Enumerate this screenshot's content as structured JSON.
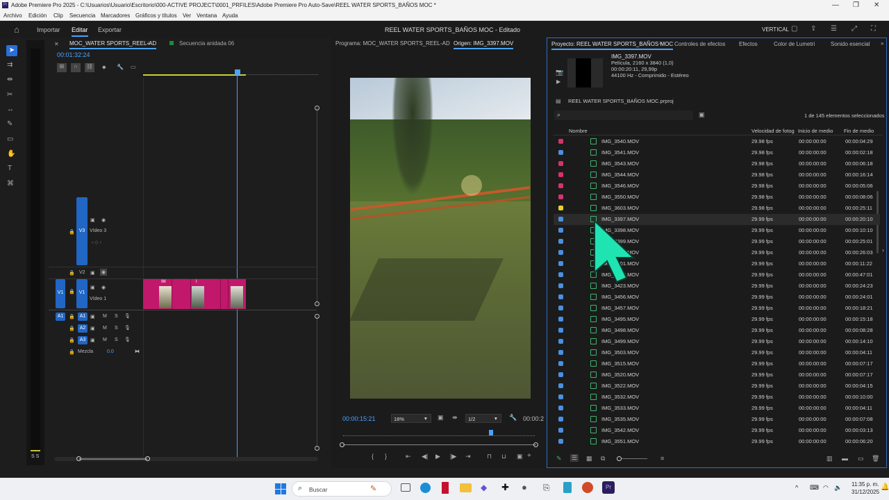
{
  "window": {
    "title": "Adobe Premiere Pro 2025 - C:\\Usuarios\\Usuario\\Escritorio\\000-ACTIVE PROJECT\\0001_PRFILES\\Adobe Premiere Pro Auto-Save\\REEL WATER SPORTS_BAÑOS MOC *",
    "minimize": "—",
    "maximize": "❐",
    "close": "✕"
  },
  "menu": [
    "Archivo",
    "Edición",
    "Clip",
    "Secuencia",
    "Marcadores",
    "Gráficos y títulos",
    "Ver",
    "Ventana",
    "Ayuda"
  ],
  "header": {
    "import": "Importar",
    "edit": "Editar",
    "export": "Exportar",
    "doc_title": "REEL WATER SPORTS_BAÑOS MOC - Editado",
    "vertical": "VERTICAL"
  },
  "timeline": {
    "tab_active": "MOC_WATER SPORTS_REEL-AD",
    "tab_other": "Secuencia anidada 06",
    "timecode": "00:01:32:24",
    "tracks": {
      "v3": "V3",
      "video3": "Vídeo 3",
      "v2": "V2",
      "v1_src": "V1",
      "v1": "V1",
      "video1": "Vídeo 1",
      "a1_src": "A1",
      "a1": "A1",
      "a2": "A2",
      "a3": "A3",
      "m": "M",
      "s": "S",
      "mix": "Mezcla",
      "mix_val": "0.0"
    },
    "clip_labels": [
      "IM",
      "I"
    ]
  },
  "program": {
    "title": "Programa: MOC_WATER SPORTS_REEL-AD",
    "source": "Origen: IMG_3397.MOV",
    "timecode": "00:00:15:21",
    "zoom": "18%",
    "quality": "1/2",
    "end_tc": "00:00:2"
  },
  "project": {
    "tab_active": "Proyecto: REEL WATER SPORTS_BAÑOS MOC",
    "tabs": [
      "Controles de efectos",
      "Efectos",
      "Color de Lumetri",
      "Sonido esencial"
    ],
    "preview": {
      "name": "IMG_3397.MOV",
      "line1": "Película, 2160 x 3840 (1,0)",
      "line2": "00:00:20:11, 29,99p",
      "line3": "44100 Hz - Comprimido - Estéreo"
    },
    "file": "REEL WATER SPORTS_BAÑOS MOC.prproj",
    "selection": "1 de 145 elementos seleccionados",
    "columns": {
      "name": "Nombre",
      "fps": "Velocidad de fotogr",
      "start": "Inicio de medio",
      "end": "Fin de medio"
    },
    "rows": [
      {
        "name": "IMG_3540.MOV",
        "fps": "29.98 fps",
        "start": "00:00:00:00",
        "end": "00:00:04:29",
        "color": "#d6336c"
      },
      {
        "name": "IMG_3541.MOV",
        "fps": "29.98 fps",
        "start": "00:00:00:00",
        "end": "00:00:02:18",
        "color": "#4a90e2"
      },
      {
        "name": "IMG_3543.MOV",
        "fps": "29.98 fps",
        "start": "00:00:00:00",
        "end": "00:00:06:18",
        "color": "#d6336c"
      },
      {
        "name": "IMG_3544.MOV",
        "fps": "29.98 fps",
        "start": "00:00:00:00",
        "end": "00:00:16:14",
        "color": "#d6336c"
      },
      {
        "name": "IMG_3546.MOV",
        "fps": "29.98 fps",
        "start": "00:00:00:00",
        "end": "00:00:05:06",
        "color": "#d6336c"
      },
      {
        "name": "IMG_3550.MOV",
        "fps": "29.98 fps",
        "start": "00:00:00:00",
        "end": "00:00:08:06",
        "color": "#d6336c"
      },
      {
        "name": "IMG_3603.MOV",
        "fps": "29.98 fps",
        "start": "00:00:00:00",
        "end": "00:00:25:11",
        "color": "#e8d12a"
      },
      {
        "name": "IMG_3397.MOV",
        "fps": "29.99 fps",
        "start": "00:00:00:00",
        "end": "00:00:20:10",
        "color": "#4a90e2"
      },
      {
        "name": "IMG_3398.MOV",
        "fps": "29.99 fps",
        "start": "00:00:00:00",
        "end": "00:00:10:10",
        "color": "#4a90e2"
      },
      {
        "name": "IMG_3399.MOV",
        "fps": "29.99 fps",
        "start": "00:00:00:00",
        "end": "00:00:25:01",
        "color": "#4a90e2"
      },
      {
        "name": "IMG_3400.MOV",
        "fps": "29.99 fps",
        "start": "00:00:00:00",
        "end": "00:00:26:03",
        "color": "#4a90e2"
      },
      {
        "name": "IMG_3401.MOV",
        "fps": "29.99 fps",
        "start": "00:00:00:00",
        "end": "00:00:11:22",
        "color": "#4a90e2"
      },
      {
        "name": "IMG_3402.MOV",
        "fps": "29.99 fps",
        "start": "00:00:00:00",
        "end": "00:00:47:01",
        "color": "#4a90e2"
      },
      {
        "name": "IMG_3423.MOV",
        "fps": "29.99 fps",
        "start": "00:00:00:00",
        "end": "00:00:24:23",
        "color": "#4a90e2"
      },
      {
        "name": "IMG_3456.MOV",
        "fps": "29.99 fps",
        "start": "00:00:00:00",
        "end": "00:00:24:01",
        "color": "#4a90e2"
      },
      {
        "name": "IMG_3457.MOV",
        "fps": "29.99 fps",
        "start": "00:00:00:00",
        "end": "00:00:18:21",
        "color": "#4a90e2"
      },
      {
        "name": "IMG_3495.MOV",
        "fps": "29.99 fps",
        "start": "00:00:00:00",
        "end": "00:00:15:18",
        "color": "#4a90e2"
      },
      {
        "name": "IMG_3498.MOV",
        "fps": "29.99 fps",
        "start": "00:00:00:00",
        "end": "00:00:08:28",
        "color": "#4a90e2"
      },
      {
        "name": "IMG_3499.MOV",
        "fps": "29.99 fps",
        "start": "00:00:00:00",
        "end": "00:00:14:10",
        "color": "#4a90e2"
      },
      {
        "name": "IMG_3503.MOV",
        "fps": "29.99 fps",
        "start": "00:00:00:00",
        "end": "00:00:04:11",
        "color": "#4a90e2"
      },
      {
        "name": "IMG_3515.MOV",
        "fps": "29.99 fps",
        "start": "00:00:00:00",
        "end": "00:00:07:17",
        "color": "#4a90e2"
      },
      {
        "name": "IMG_3520.MOV",
        "fps": "29.99 fps",
        "start": "00:00:00:00",
        "end": "00:00:07:17",
        "color": "#4a90e2"
      },
      {
        "name": "IMG_3522.MOV",
        "fps": "29.99 fps",
        "start": "00:00:00:00",
        "end": "00:00:04:15",
        "color": "#4a90e2"
      },
      {
        "name": "IMG_3532.MOV",
        "fps": "29.99 fps",
        "start": "00:00:00:00",
        "end": "00:00:10:00",
        "color": "#4a90e2"
      },
      {
        "name": "IMG_3533.MOV",
        "fps": "29.99 fps",
        "start": "00:00:00:00",
        "end": "00:00:04:11",
        "color": "#4a90e2"
      },
      {
        "name": "IMG_3535.MOV",
        "fps": "29.99 fps",
        "start": "00:00:00:00",
        "end": "00:00:07:08",
        "color": "#4a90e2"
      },
      {
        "name": "IMG_3542.MOV",
        "fps": "29.99 fps",
        "start": "00:00:00:00",
        "end": "00:00:03:13",
        "color": "#4a90e2"
      },
      {
        "name": "IMG_3551.MOV",
        "fps": "29.99 fps",
        "start": "00:00:00:00",
        "end": "00:00:06:20",
        "color": "#4a90e2"
      }
    ]
  },
  "taskbar": {
    "search": "Buscar",
    "time": "11:35 p. m.",
    "date": "31/12/2025"
  },
  "audio_meter": {
    "label": "S S"
  }
}
